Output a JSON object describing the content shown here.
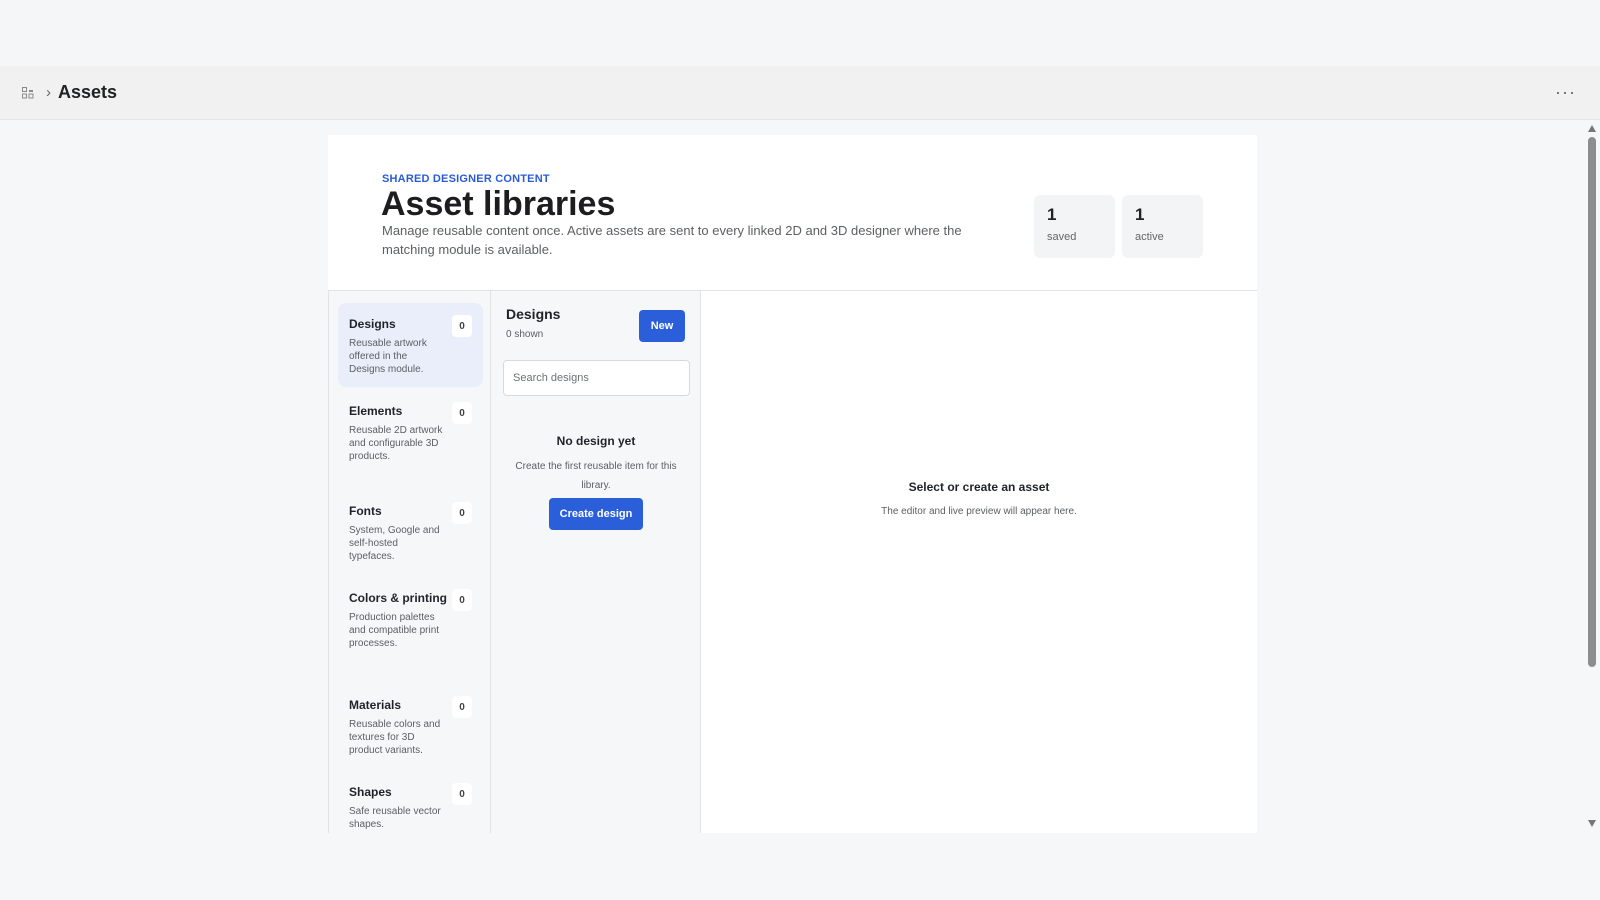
{
  "header": {
    "title": "Assets",
    "breadcrumb_separator": "›",
    "app_icon": "apps-icon",
    "more_icon": "more-dots-icon",
    "more_glyph": "···"
  },
  "hero": {
    "eyebrow": "SHARED DESIGNER CONTENT",
    "title": "Asset libraries",
    "description": "Manage reusable content once. Active assets are sent to every linked 2D and 3D designer where the matching module is available.",
    "stats": [
      {
        "value": "1",
        "label": "saved"
      },
      {
        "value": "1",
        "label": "active"
      }
    ]
  },
  "categories": [
    {
      "name": "Designs",
      "description": "Reusable artwork offered in the Designs module.",
      "count": "0",
      "active": true
    },
    {
      "name": "Elements",
      "description": "Reusable 2D artwork and configurable 3D products.",
      "count": "0"
    },
    {
      "name": "Fonts",
      "description": "System, Google and self-hosted typefaces.",
      "count": "0"
    },
    {
      "name": "Colors & printing",
      "description": "Production palettes and compatible print processes.",
      "count": "0"
    },
    {
      "name": "Materials",
      "description": "Reusable colors and textures for 3D product variants.",
      "count": "0"
    },
    {
      "name": "Shapes",
      "description": "Safe reusable vector shapes.",
      "count": "0"
    }
  ],
  "list": {
    "title": "Designs",
    "shown": "0 shown",
    "new_label": "New",
    "search_placeholder": "Search designs",
    "empty_title": "No design yet",
    "empty_description": "Create the first reusable item for this library.",
    "create_label": "Create design"
  },
  "editor": {
    "empty_title": "Select or create an asset",
    "empty_description": "The editor and live preview will appear here."
  },
  "colors": {
    "accent": "#2b5fd9",
    "eyebrow": "#2a5bd7",
    "active_category_bg": "#e9eefa"
  }
}
